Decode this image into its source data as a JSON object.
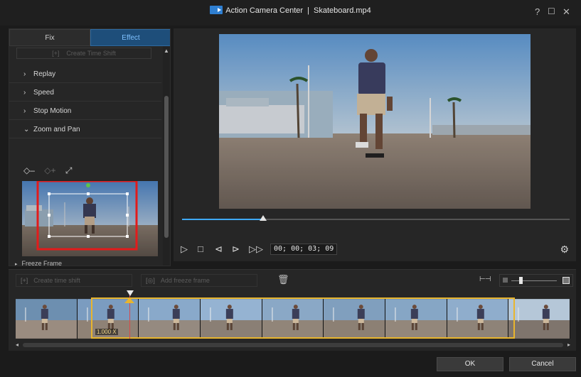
{
  "window": {
    "app_name": "Action Camera Center",
    "separator": "|",
    "file_name": "Skateboard.mp4",
    "controls": {
      "help": "?",
      "maximize": "☐",
      "close": "✕"
    }
  },
  "left_panel": {
    "tabs": [
      {
        "label": "Fix",
        "active": false
      },
      {
        "label": "Effect",
        "active": true
      }
    ],
    "ghost_button": "Create Time Shift",
    "sections": [
      {
        "label": "Replay",
        "expanded": false
      },
      {
        "label": "Speed",
        "expanded": false
      },
      {
        "label": "Stop Motion",
        "expanded": false
      },
      {
        "label": "Zoom and Pan",
        "expanded": true
      }
    ],
    "zoom_pan_tools": {
      "remove_keyframe": "◇–",
      "add_keyframe": "◇+",
      "fit": "⤢"
    },
    "freeze_frame_label": "Freeze Frame"
  },
  "preview": {
    "seek_progress": 0.21,
    "timecode": "00; 00; 03; 09"
  },
  "timeline_toolbar": {
    "create_time_shift": "Create time shift",
    "add_freeze_frame": "Add freeze frame",
    "zoom_level": 0.17
  },
  "timeline": {
    "speed_label": "1.000 X",
    "frame_count": 9
  },
  "buttons": {
    "ok": "OK",
    "cancel": "Cancel"
  },
  "colors": {
    "accent_blue": "#3fa9f5",
    "selection_yellow": "#e8b52e",
    "playhead_red": "#d94a4a",
    "highlight_red": "#e21b1b"
  }
}
